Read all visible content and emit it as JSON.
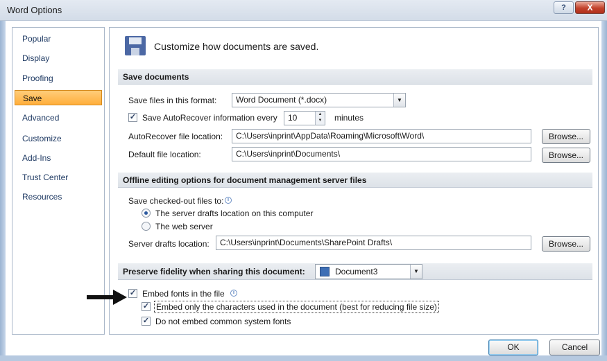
{
  "window": {
    "title": "Word Options",
    "help_glyph": "?",
    "close_glyph": "X"
  },
  "nav": {
    "items": [
      {
        "label": "Popular"
      },
      {
        "label": "Display"
      },
      {
        "label": "Proofing"
      },
      {
        "label": "Save",
        "selected": true
      },
      {
        "label": "Advanced"
      },
      {
        "label": "Customize"
      },
      {
        "label": "Add-Ins"
      },
      {
        "label": "Trust Center"
      },
      {
        "label": "Resources"
      }
    ]
  },
  "header": {
    "text": "Customize how documents are saved.",
    "icon": "floppy-disk-icon"
  },
  "save_documents": {
    "section_title": "Save documents",
    "format_label": "Save files in this format:",
    "format_value": "Word Document (*.docx)",
    "autorecover_checkbox_label": "Save AutoRecover information every",
    "autorecover_checked": true,
    "autorecover_minutes": "10",
    "minutes_label": "minutes",
    "autorecover_location_label": "AutoRecover file location:",
    "autorecover_location_value": "C:\\Users\\inprint\\AppData\\Roaming\\Microsoft\\Word\\",
    "default_location_label": "Default file location:",
    "default_location_value": "C:\\Users\\inprint\\Documents\\",
    "browse_label": "Browse..."
  },
  "offline_editing": {
    "section_title": "Offline editing options for document management server files",
    "checked_out_label": "Save checked-out files to:",
    "radio_server_drafts": "The server drafts location on this computer",
    "radio_web_server": "The web server",
    "selected_option": "The server drafts location on this computer",
    "drafts_location_label": "Server drafts location:",
    "drafts_location_value": "C:\\Users\\inprint\\Documents\\SharePoint Drafts\\",
    "browse_label": "Browse..."
  },
  "fidelity": {
    "section_title": "Preserve fidelity when sharing this document:",
    "document_value": "Document3",
    "embed_fonts_label": "Embed fonts in the file",
    "embed_fonts_checked": true,
    "embed_chars_label": "Embed only the characters used in the document (best for reducing file size)",
    "embed_chars_checked": true,
    "no_common_fonts_label": "Do not embed common system fonts",
    "no_common_fonts_checked": true
  },
  "footer": {
    "ok_label": "OK",
    "cancel_label": "Cancel"
  },
  "colors": {
    "accent": "#ffae3b",
    "title_bar": "#d3dce8",
    "close_button": "#c2422b"
  }
}
